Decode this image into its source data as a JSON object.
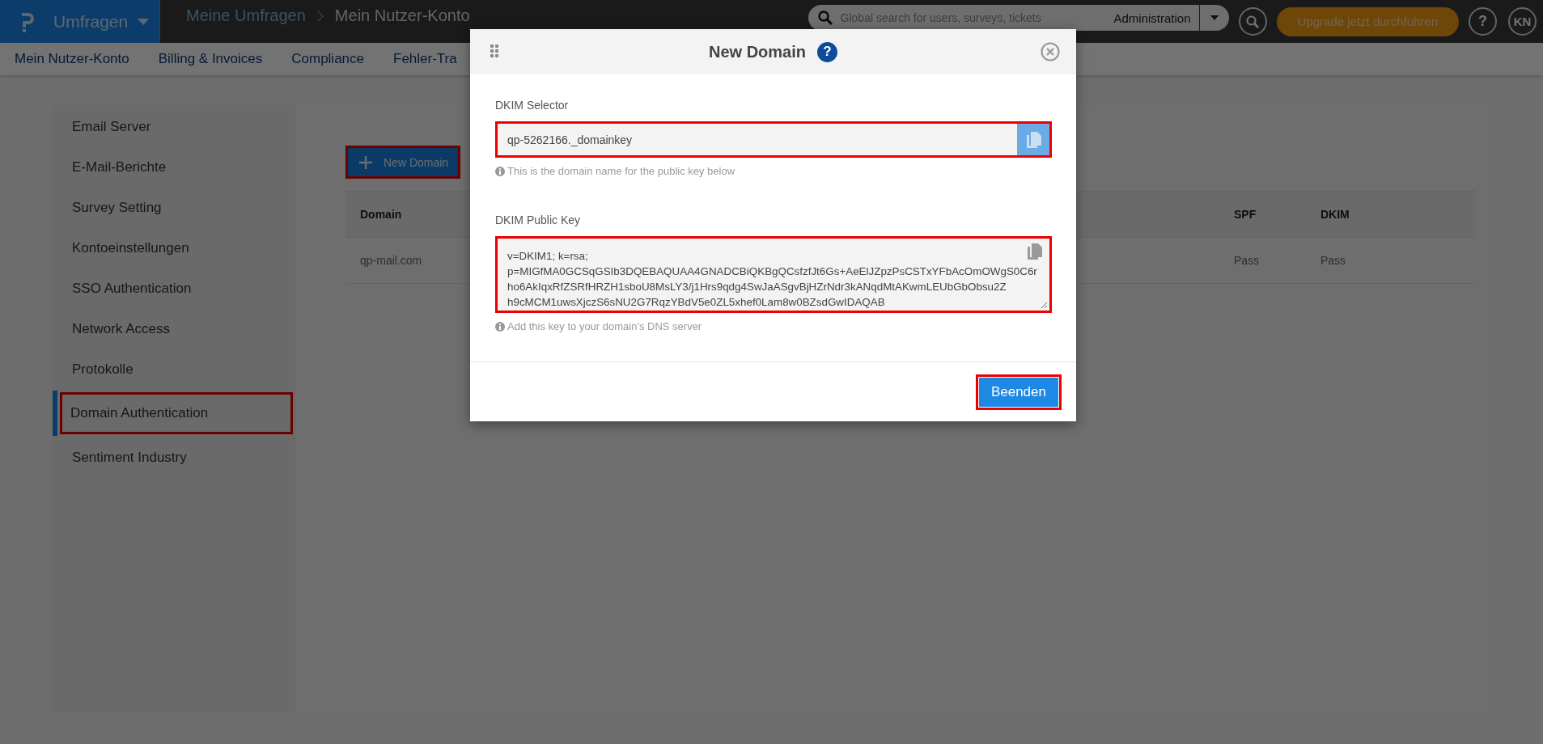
{
  "topbar": {
    "app_menu": "Umfragen",
    "breadcrumb": [
      "Meine Umfragen",
      "Mein Nutzer-Konto"
    ],
    "search": {
      "placeholder": "Global search for users, surveys, tickets",
      "scope": "Administration"
    },
    "upgrade": "Upgrade jetzt durchführen",
    "help": "?",
    "avatar": "KN"
  },
  "nav": [
    "Mein Nutzer-Konto",
    "Billing & Invoices",
    "Compliance",
    "Fehler-Tra"
  ],
  "sidebar": {
    "items": [
      {
        "label": "Email Server",
        "selected": false
      },
      {
        "label": "E-Mail-Berichte",
        "selected": false
      },
      {
        "label": "Survey Setting",
        "selected": false
      },
      {
        "label": "Kontoeinstellungen",
        "selected": false
      },
      {
        "label": "SSO Authentication",
        "selected": false
      },
      {
        "label": "Network Access",
        "selected": false
      },
      {
        "label": "Protokolle",
        "selected": false
      },
      {
        "label": "Domain Authentication",
        "selected": true
      },
      {
        "label": "Sentiment Industry",
        "selected": false
      }
    ]
  },
  "main": {
    "new_button": "New Domain",
    "table": {
      "columns": [
        "Domain",
        "SPF",
        "DKIM"
      ],
      "rows": [
        [
          "qp-mail.com",
          "Pass",
          "Pass"
        ]
      ]
    }
  },
  "modal": {
    "title": "New Domain",
    "help": "?",
    "fields": [
      {
        "kind": "input",
        "label": "DKIM Selector",
        "value": "qp-5262166._domainkey",
        "hint": "This is the domain name for the public key below"
      },
      {
        "kind": "textarea",
        "label": "DKIM Public Key",
        "value": "v=DKIM1; k=rsa;\np=MIGfMA0GCSqGSIb3DQEBAQUAA4GNADCBiQKBgQCsfzfJt6Gs+AeElJZpzPsCSTxYFbAcOmOWgS0C6r\nho6AkIqxRfZSRfHRZH1sboU8MsLY3/j1Hrs9qdg4SwJaASgvBjHZrNdr3kANqdMtAKwmLEUbGbObsu2Z\nh9cMCM1uwsXjczS6sNU2G7RqzYBdV5e0ZL5xhef0Lam8w0BZsdGwIDAQAB",
        "hint": "Add this key to your domain's DNS server"
      }
    ],
    "button": "Beenden"
  }
}
